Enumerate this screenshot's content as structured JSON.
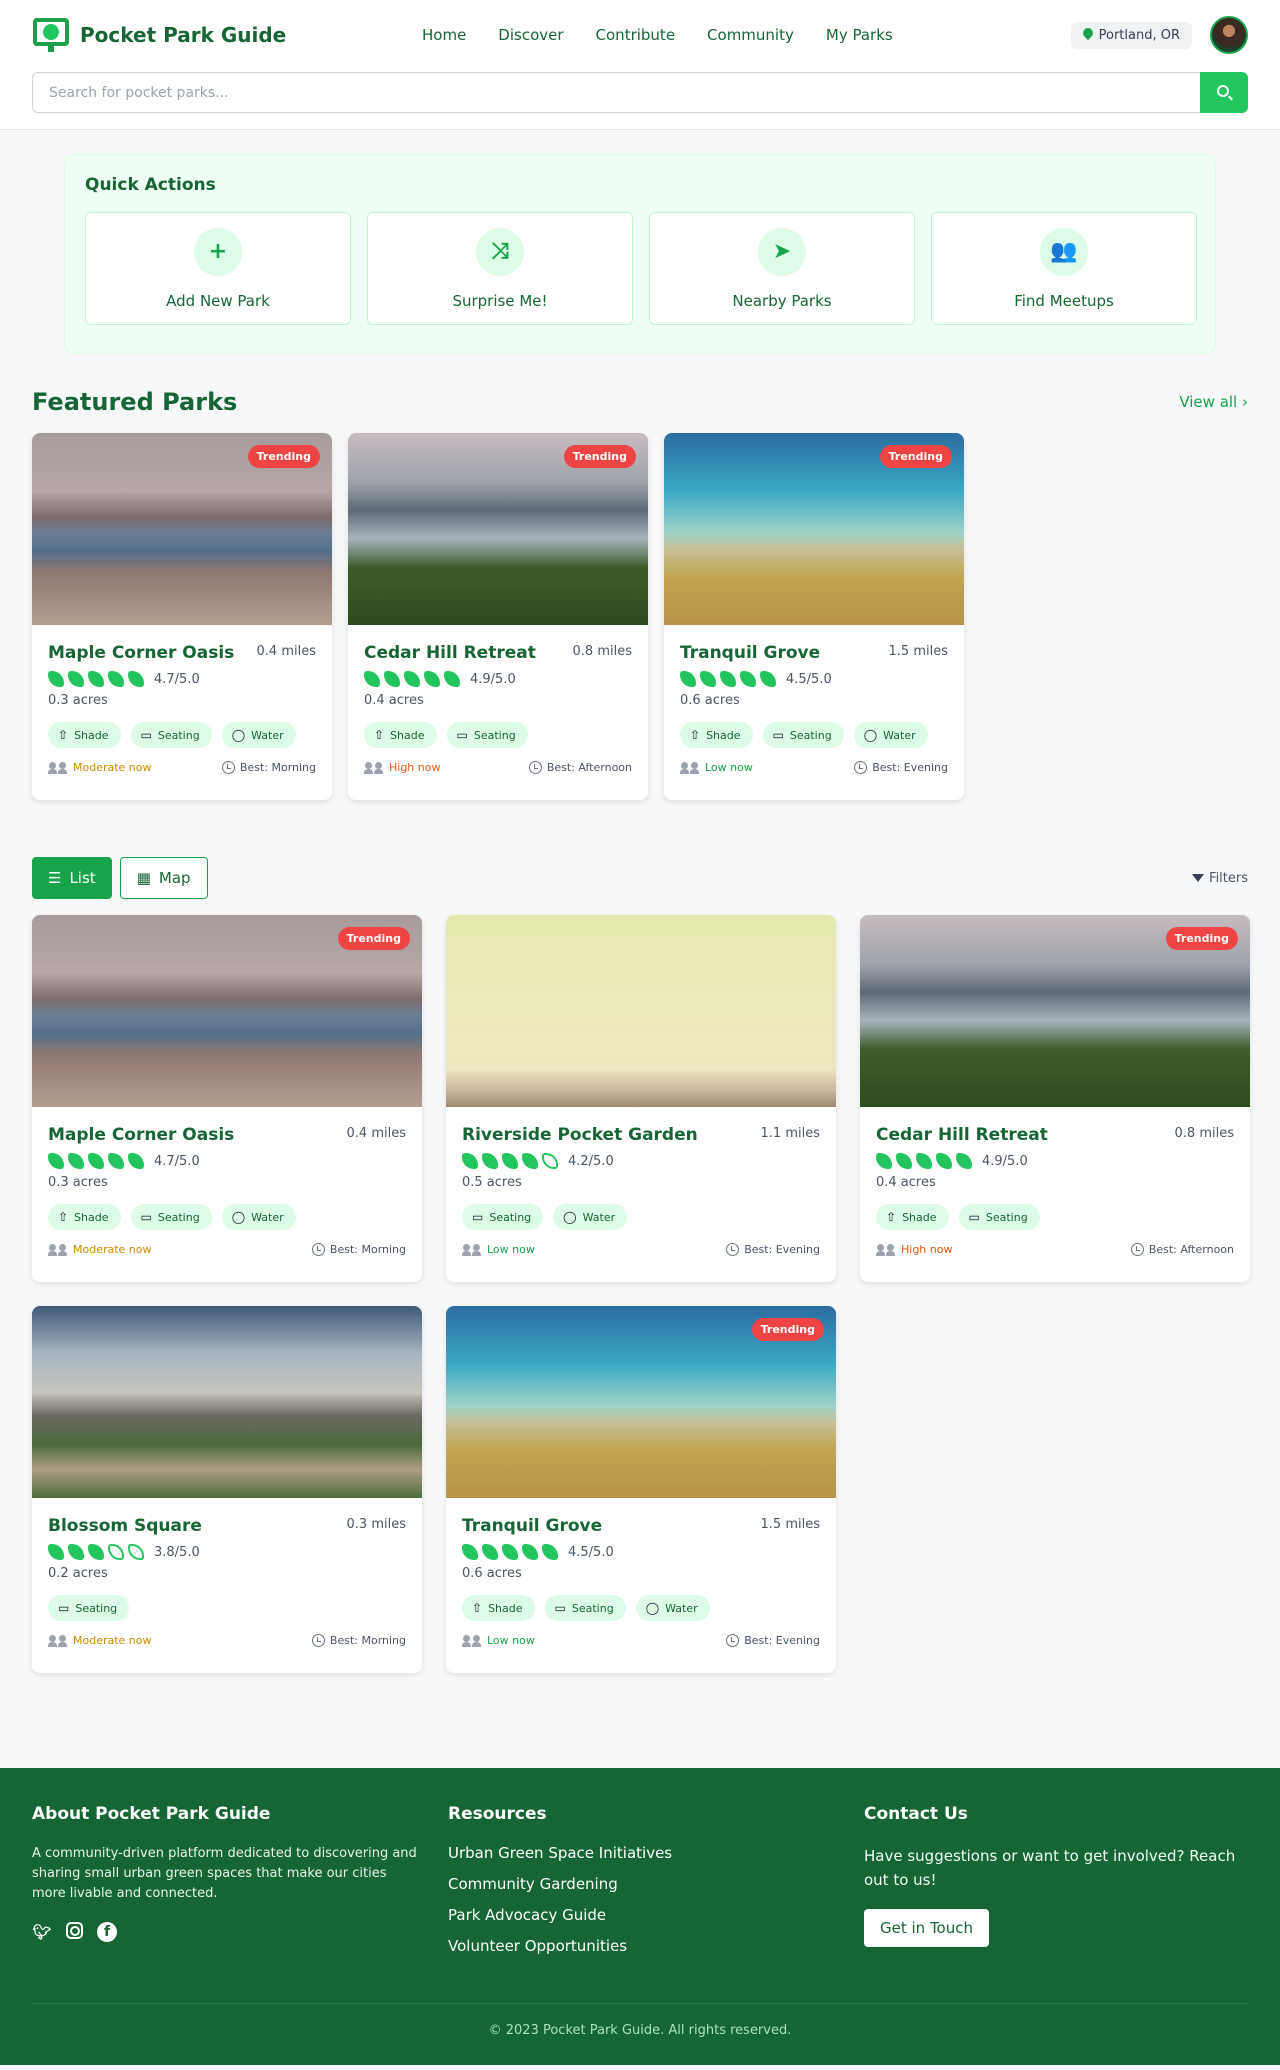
{
  "header": {
    "brand": "Pocket Park Guide",
    "nav": [
      "Home",
      "Discover",
      "Contribute",
      "Community",
      "My Parks"
    ],
    "location": "Portland, OR",
    "search_placeholder": "Search for pocket parks..."
  },
  "quick_actions": {
    "title": "Quick Actions",
    "items": [
      {
        "label": "Add New Park",
        "icon": "plus-icon",
        "glyph": "+"
      },
      {
        "label": "Surprise Me!",
        "icon": "shuffle-icon",
        "glyph": "⤨"
      },
      {
        "label": "Nearby Parks",
        "icon": "location-arrow-icon",
        "glyph": "➤"
      },
      {
        "label": "Find Meetups",
        "icon": "users-icon",
        "glyph": "👥"
      }
    ]
  },
  "featured": {
    "title": "Featured Parks",
    "view_all": "View all ›"
  },
  "parks": {
    "maple": {
      "name": "Maple Corner Oasis",
      "distance": "0.4 miles",
      "rating": 4.7,
      "rating_text": "4.7/5.0",
      "acres": "0.3 acres",
      "amenities": [
        "Shade",
        "Seating",
        "Water"
      ],
      "crowd": "Moderate now",
      "crowd_level": "moderate",
      "best": "Best: Morning",
      "trending": true,
      "trending_label": "Trending",
      "image": "img-maple"
    },
    "cedar": {
      "name": "Cedar Hill Retreat",
      "distance": "0.8 miles",
      "rating": 4.9,
      "rating_text": "4.9/5.0",
      "acres": "0.4 acres",
      "amenities": [
        "Shade",
        "Seating"
      ],
      "crowd": "High now",
      "crowd_level": "high",
      "best": "Best: Afternoon",
      "trending": true,
      "trending_label": "Trending",
      "image": "img-cedar"
    },
    "tranquil": {
      "name": "Tranquil Grove",
      "distance": "1.5 miles",
      "rating": 4.5,
      "rating_text": "4.5/5.0",
      "acres": "0.6 acres",
      "amenities": [
        "Shade",
        "Seating",
        "Water"
      ],
      "crowd": "Low now",
      "crowd_level": "low",
      "best": "Best: Evening",
      "trending": true,
      "trending_label": "Trending",
      "image": "img-tranquil"
    },
    "riverside": {
      "name": "Riverside Pocket Garden",
      "distance": "1.1 miles",
      "rating": 4.2,
      "rating_text": "4.2/5.0",
      "acres": "0.5 acres",
      "amenities": [
        "Seating",
        "Water"
      ],
      "crowd": "Low now",
      "crowd_level": "low",
      "best": "Best: Evening",
      "trending": false,
      "image": "img-riverside"
    },
    "blossom": {
      "name": "Blossom Square",
      "distance": "0.3 miles",
      "rating": 3.8,
      "rating_text": "3.8/5.0",
      "acres": "0.2 acres",
      "amenities": [
        "Seating"
      ],
      "crowd": "Moderate now",
      "crowd_level": "moderate",
      "best": "Best: Morning",
      "trending": false,
      "image": "img-blossom"
    }
  },
  "featured_order": [
    "maple",
    "cedar",
    "tranquil"
  ],
  "list_order": [
    "maple",
    "riverside",
    "cedar",
    "blossom",
    "tranquil"
  ],
  "amenity_icons": {
    "Shade": "⇧",
    "Seating": "▭",
    "Water": "◯"
  },
  "view_toggle": {
    "list_label": "List",
    "map_label": "Map",
    "active": "list",
    "filters_label": "Filters"
  },
  "footer": {
    "about_title": "About Pocket Park Guide",
    "about_text": "A community-driven platform dedicated to discovering and sharing small urban green spaces that make our cities more livable and connected.",
    "resources_title": "Resources",
    "resources": [
      "Urban Green Space Initiatives",
      "Community Gardening",
      "Park Advocacy Guide",
      "Volunteer Opportunities"
    ],
    "contact_title": "Contact Us",
    "contact_text": "Have suggestions or want to get involved? Reach out to us!",
    "contact_button": "Get in Touch",
    "copyright": "© 2023 Pocket Park Guide. All rights reserved."
  }
}
